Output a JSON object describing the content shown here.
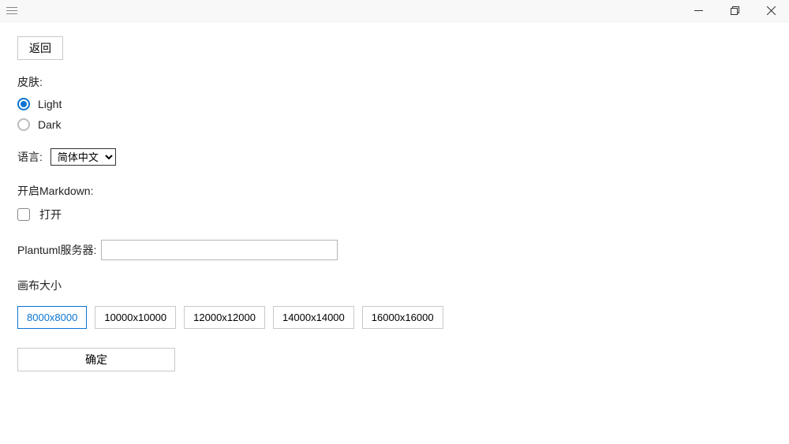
{
  "titlebar": {
    "menu_name": "hamburger-icon"
  },
  "buttons": {
    "back": "返回",
    "confirm": "确定"
  },
  "skin": {
    "label": "皮肤:",
    "options": [
      {
        "label": "Light",
        "selected": true
      },
      {
        "label": "Dark",
        "selected": false
      }
    ]
  },
  "language": {
    "label": "语言:",
    "selected": "简体中文",
    "options": [
      "简体中文"
    ]
  },
  "markdown": {
    "label": "开启Markdown:",
    "enable_label": "打开",
    "checked": false
  },
  "plantuml": {
    "label": "Plantuml服务器:",
    "value": ""
  },
  "canvas": {
    "label": "画布大小",
    "sizes": [
      {
        "label": "8000x8000",
        "selected": true
      },
      {
        "label": "10000x10000",
        "selected": false
      },
      {
        "label": "12000x12000",
        "selected": false
      },
      {
        "label": "14000x14000",
        "selected": false
      },
      {
        "label": "16000x16000",
        "selected": false
      }
    ]
  }
}
